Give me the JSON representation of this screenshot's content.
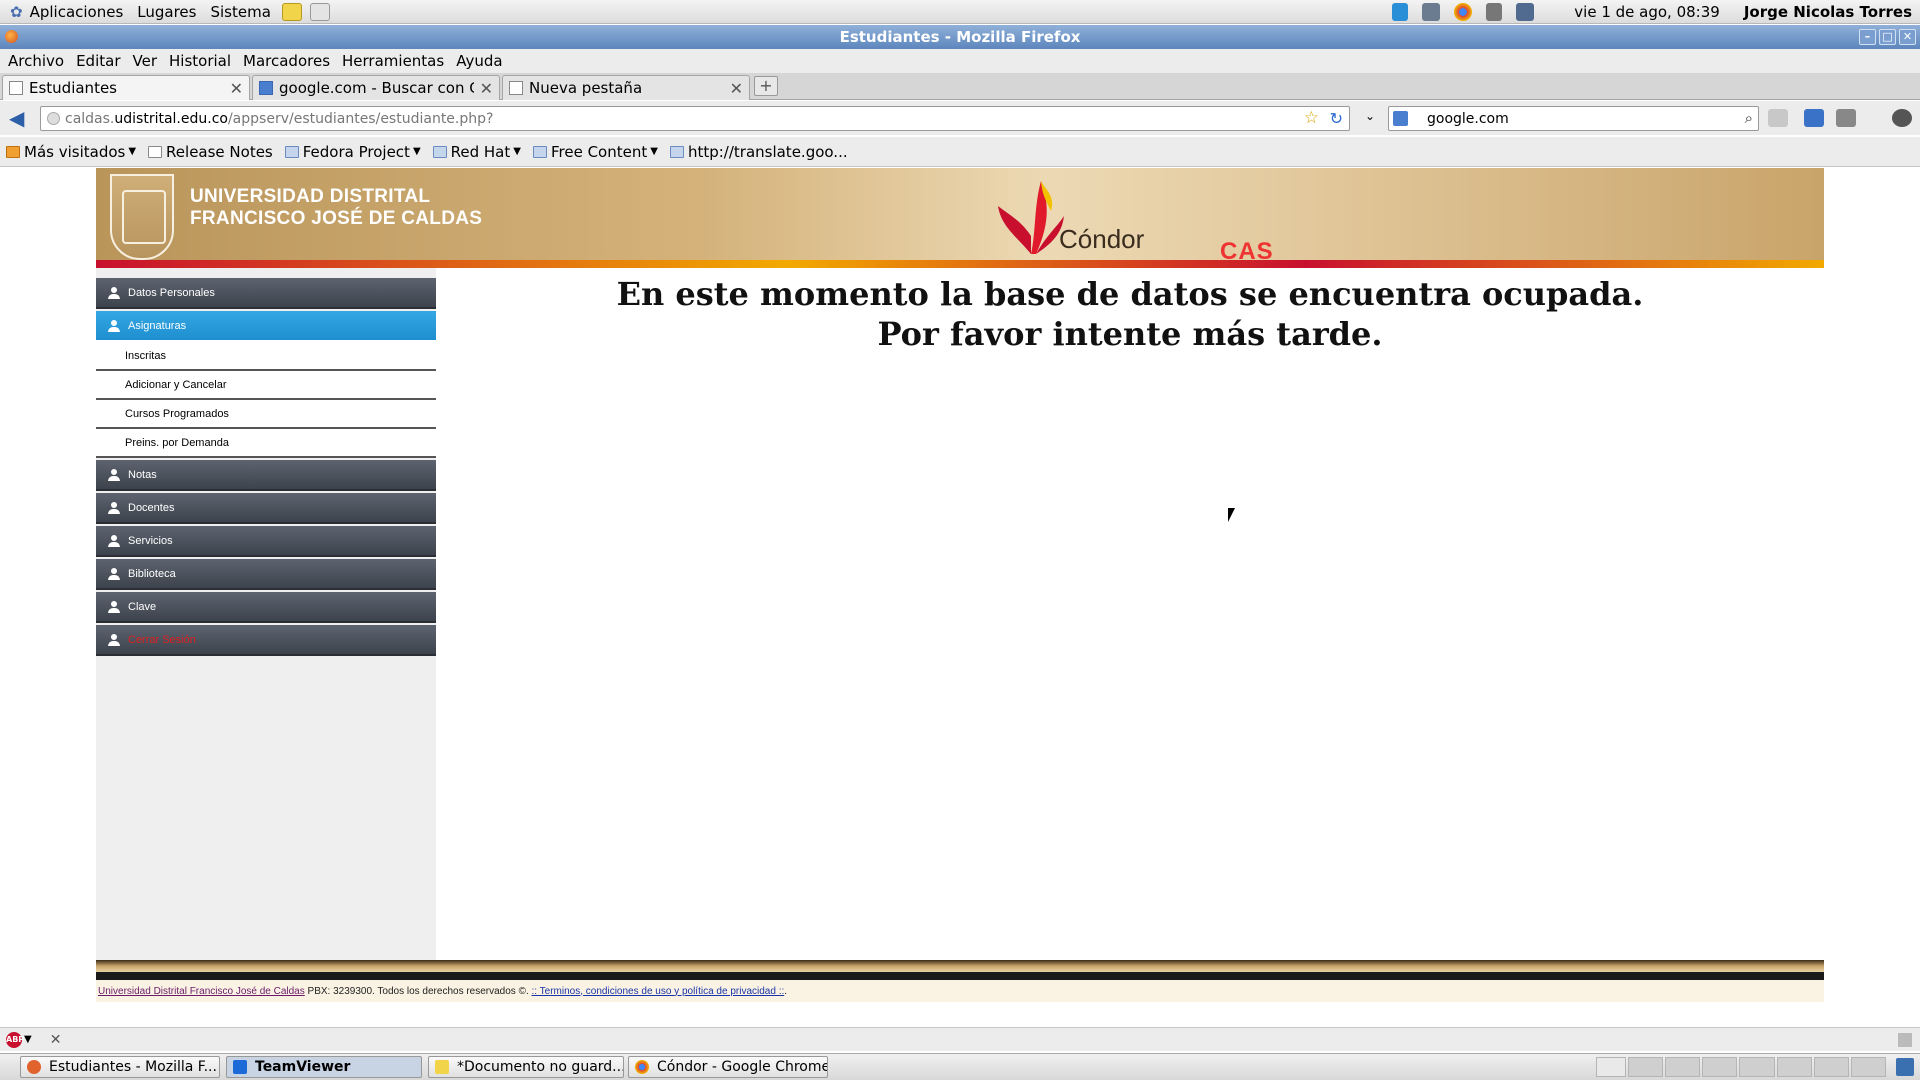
{
  "system": {
    "menus": [
      "Aplicaciones",
      "Lugares",
      "Sistema"
    ],
    "clock": "vie  1 de ago, 08:39",
    "user": "Jorge Nicolas Torres"
  },
  "window": {
    "title": "Estudiantes - Mozilla Firefox"
  },
  "menubar": [
    "Archivo",
    "Editar",
    "Ver",
    "Historial",
    "Marcadores",
    "Herramientas",
    "Ayuda"
  ],
  "tabs": [
    {
      "label": "Estudiantes"
    },
    {
      "label": "google.com - Buscar con Go..."
    },
    {
      "label": "Nueva pestaña"
    }
  ],
  "navbar": {
    "url_prefix": "caldas.",
    "url_domain": "udistrital.edu.co",
    "url_path": "/appserv/estudiantes/estudiante.php?",
    "search_value": "google.com"
  },
  "bookmarks": [
    {
      "label": "Más visitados",
      "has_menu": true
    },
    {
      "label": "Release Notes",
      "has_menu": false
    },
    {
      "label": "Fedora Project",
      "has_menu": true
    },
    {
      "label": "Red Hat",
      "has_menu": true
    },
    {
      "label": "Free Content",
      "has_menu": true
    },
    {
      "label": "http://translate.goo...",
      "has_menu": false
    }
  ],
  "banner": {
    "university_line1": "UNIVERSIDAD DISTRITAL",
    "university_line2": "FRANCISCO JOSÉ DE CALDAS",
    "brand": "Cóndor",
    "cas": "CAS"
  },
  "sidebar": {
    "items": [
      {
        "label": "Datos Personales"
      },
      {
        "label": "Asignaturas"
      },
      {
        "label": "Inscritas"
      },
      {
        "label": "Adicionar y Cancelar"
      },
      {
        "label": "Cursos Programados"
      },
      {
        "label": "Preins. por Demanda"
      },
      {
        "label": "Notas"
      },
      {
        "label": "Docentes"
      },
      {
        "label": "Servicios"
      },
      {
        "label": "Biblioteca"
      },
      {
        "label": "Clave"
      },
      {
        "label": "Cerrar Sesión"
      }
    ]
  },
  "main": {
    "message_line1": "En este momento la base de datos se encuentra ocupada.",
    "message_line2": "Por favor intente más tarde."
  },
  "footer": {
    "link1": "Universidad Distrital Francisco José de Caldas",
    "text": " PBX: 3239300. Todos los derechos reservados ©. ",
    "link2": ":: Terminos, condiciones de uso y política de privacidad ::",
    "tail": "."
  },
  "taskbar": [
    {
      "label": "Estudiantes - Mozilla F..."
    },
    {
      "label": "TeamViewer"
    },
    {
      "label": "*Documento no guard..."
    },
    {
      "label": "Cóndor - Google Chrome"
    }
  ],
  "colors": {
    "accent": "#1d8fd0",
    "menu_dark": "#4a5059",
    "logout": "#e02020"
  }
}
